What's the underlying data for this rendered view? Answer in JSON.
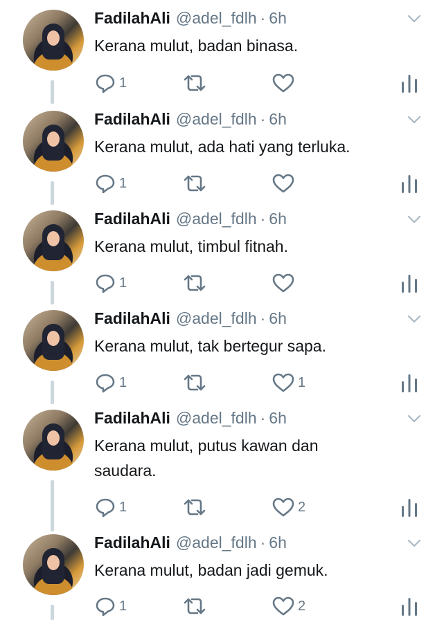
{
  "user": {
    "name": "FadilahAli",
    "handle": "@adel_fdlh",
    "separator": "·"
  },
  "colors": {
    "text": "#14171a",
    "secondary": "#657786",
    "thread_line": "#ccd6dd",
    "background": "#ffffff"
  },
  "icons": {
    "reply": "reply-icon",
    "retweet": "retweet-icon",
    "like": "heart-icon",
    "stats": "analytics-icon",
    "menu": "chevron-down-icon"
  },
  "tweets": [
    {
      "time": "6h",
      "text": "Kerana mulut, badan binasa.",
      "replies": "1",
      "retweets": "",
      "likes": ""
    },
    {
      "time": "6h",
      "text": "Kerana mulut, ada hati yang terluka.",
      "replies": "1",
      "retweets": "",
      "likes": ""
    },
    {
      "time": "6h",
      "text": "Kerana mulut, timbul fitnah.",
      "replies": "1",
      "retweets": "",
      "likes": ""
    },
    {
      "time": "6h",
      "text": "Kerana mulut, tak bertegur sapa.",
      "replies": "1",
      "retweets": "",
      "likes": "1"
    },
    {
      "time": "6h",
      "text": "Kerana mulut, putus kawan dan saudara.",
      "replies": "1",
      "retweets": "",
      "likes": "2"
    },
    {
      "time": "6h",
      "text": "Kerana mulut, badan jadi gemuk.",
      "replies": "1",
      "retweets": "",
      "likes": "2"
    }
  ]
}
